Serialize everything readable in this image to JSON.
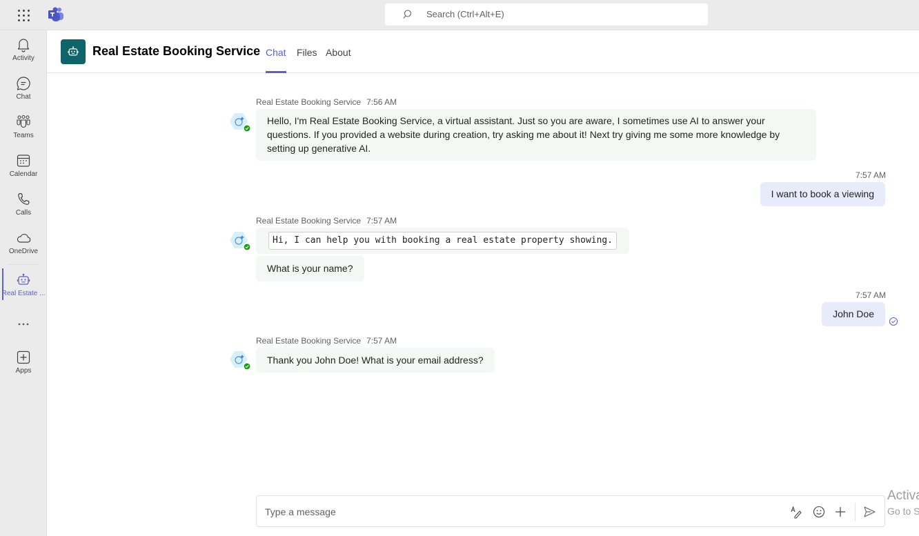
{
  "topbar": {
    "search_placeholder": "Search (Ctrl+Alt+E)"
  },
  "rail": {
    "items": [
      {
        "label": "Activity",
        "icon": "bell-icon"
      },
      {
        "label": "Chat",
        "icon": "chat-icon"
      },
      {
        "label": "Teams",
        "icon": "teams-icon"
      },
      {
        "label": "Calendar",
        "icon": "calendar-icon"
      },
      {
        "label": "Calls",
        "icon": "phone-icon"
      },
      {
        "label": "OneDrive",
        "icon": "cloud-icon"
      },
      {
        "label": "Real Estate ...",
        "icon": "bot-icon",
        "active": true
      },
      {
        "label": "",
        "icon": "more-icon"
      },
      {
        "label": "Apps",
        "icon": "add-apps-icon"
      }
    ]
  },
  "header": {
    "title": "Real Estate Booking Service",
    "tabs": [
      {
        "label": "Chat",
        "active": true
      },
      {
        "label": "Files"
      },
      {
        "label": "About"
      }
    ]
  },
  "messages": [
    {
      "sender": "Real Estate Booking Service",
      "time": "7:56 AM",
      "from": "bot",
      "text": "Hello, I'm Real Estate Booking Service, a virtual assistant. Just so you are aware, I sometimes use AI to answer your questions. If you provided a website during creation, try asking me about it! Next try giving me some more knowledge by setting up generative AI."
    },
    {
      "time": "7:57 AM",
      "from": "me",
      "text": "I want to book a viewing"
    },
    {
      "sender": "Real Estate Booking Service",
      "time": "7:57 AM",
      "from": "bot",
      "code_text": "Hi, I can help you with booking a real estate property showing.",
      "followup": "What is your name?"
    },
    {
      "time": "7:57 AM",
      "from": "me",
      "text": "John Doe",
      "status": "read"
    },
    {
      "sender": "Real Estate Booking Service",
      "time": "7:57 AM",
      "from": "bot",
      "text": "Thank you John Doe! What is your email address?"
    }
  ],
  "composer": {
    "placeholder": "Type a message",
    "value": ""
  },
  "watermark": {
    "line1": "Activa",
    "line2": "Go to S"
  },
  "colors": {
    "accent": "#5b5fc7",
    "app_icon_bg": "#0f6469",
    "bot_bubble": "#f4f8f5",
    "my_bubble": "#e8ebfa",
    "online": "#13a10e"
  }
}
